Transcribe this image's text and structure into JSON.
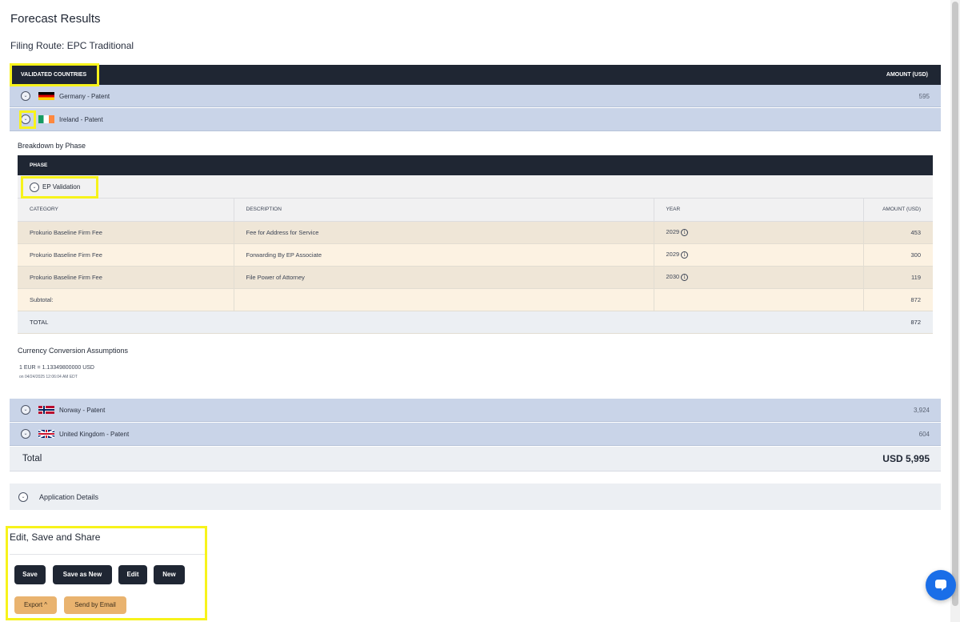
{
  "page": {
    "title": "Forecast Results",
    "filing_route": "Filing Route: EPC Traditional"
  },
  "table_header": {
    "left": "VALIDATED COUNTRIES",
    "right": "AMOUNT (USD)"
  },
  "countries": [
    {
      "name": "Germany - Patent",
      "amount": "595",
      "flag": "germany-flag"
    },
    {
      "name": "Ireland - Patent",
      "amount": "",
      "flag": "ireland-flag"
    },
    {
      "name": "Norway - Patent",
      "amount": "3,924",
      "flag": "norway-flag"
    },
    {
      "name": "United Kingdom - Patent",
      "amount": "604",
      "flag": "uk-flag"
    }
  ],
  "breakdown": {
    "title": "Breakdown by Phase",
    "phase_header": "PHASE",
    "phase_name": "EP Validation",
    "columns": [
      "CATEGORY",
      "DESCRIPTION",
      "YEAR",
      "AMOUNT (USD)"
    ],
    "rows": [
      {
        "category": "Prokurio Baseline Firm Fee",
        "description": "Fee for Address for Service",
        "year": "2029",
        "amount": "453"
      },
      {
        "category": "Prokurio Baseline Firm Fee",
        "description": "Forwarding By EP Associate",
        "year": "2029",
        "amount": "300"
      },
      {
        "category": "Prokurio Baseline Firm Fee",
        "description": "File Power of Attorney",
        "year": "2030",
        "amount": "119"
      }
    ],
    "subtotal_label": "Subtotal:",
    "subtotal_value": "872",
    "total_label": "TOTAL",
    "total_value": "872",
    "info_glyph": "i"
  },
  "currency": {
    "title": "Currency Conversion Assumptions",
    "rate": "1 EUR = 1.13349800000 USD",
    "date": "on 04/24/2025 12:06:04 AM EDT"
  },
  "total": {
    "label": "Total",
    "value": "USD 5,995"
  },
  "application_details": {
    "label": "Application Details"
  },
  "share": {
    "title": "Edit, Save and Share",
    "save": "Save",
    "save_as_new": "Save as New",
    "edit": "Edit",
    "new": "New",
    "export": "Export ^",
    "send_email": "Send by Email"
  },
  "colors": {
    "header_dark": "#1f2633",
    "country_row": "#c9d4e8",
    "fee_row_dark": "#efe6d7",
    "fee_row_light": "#fcf2e2",
    "orange_button": "#e9b36f",
    "highlight": "#f7f31b",
    "chat_button": "#1a6ee8"
  },
  "icons": {
    "toggle": "chevron-toggle-icon",
    "info": "info-icon",
    "chat": "chat-icon"
  },
  "toggle_glyph": "⌄"
}
